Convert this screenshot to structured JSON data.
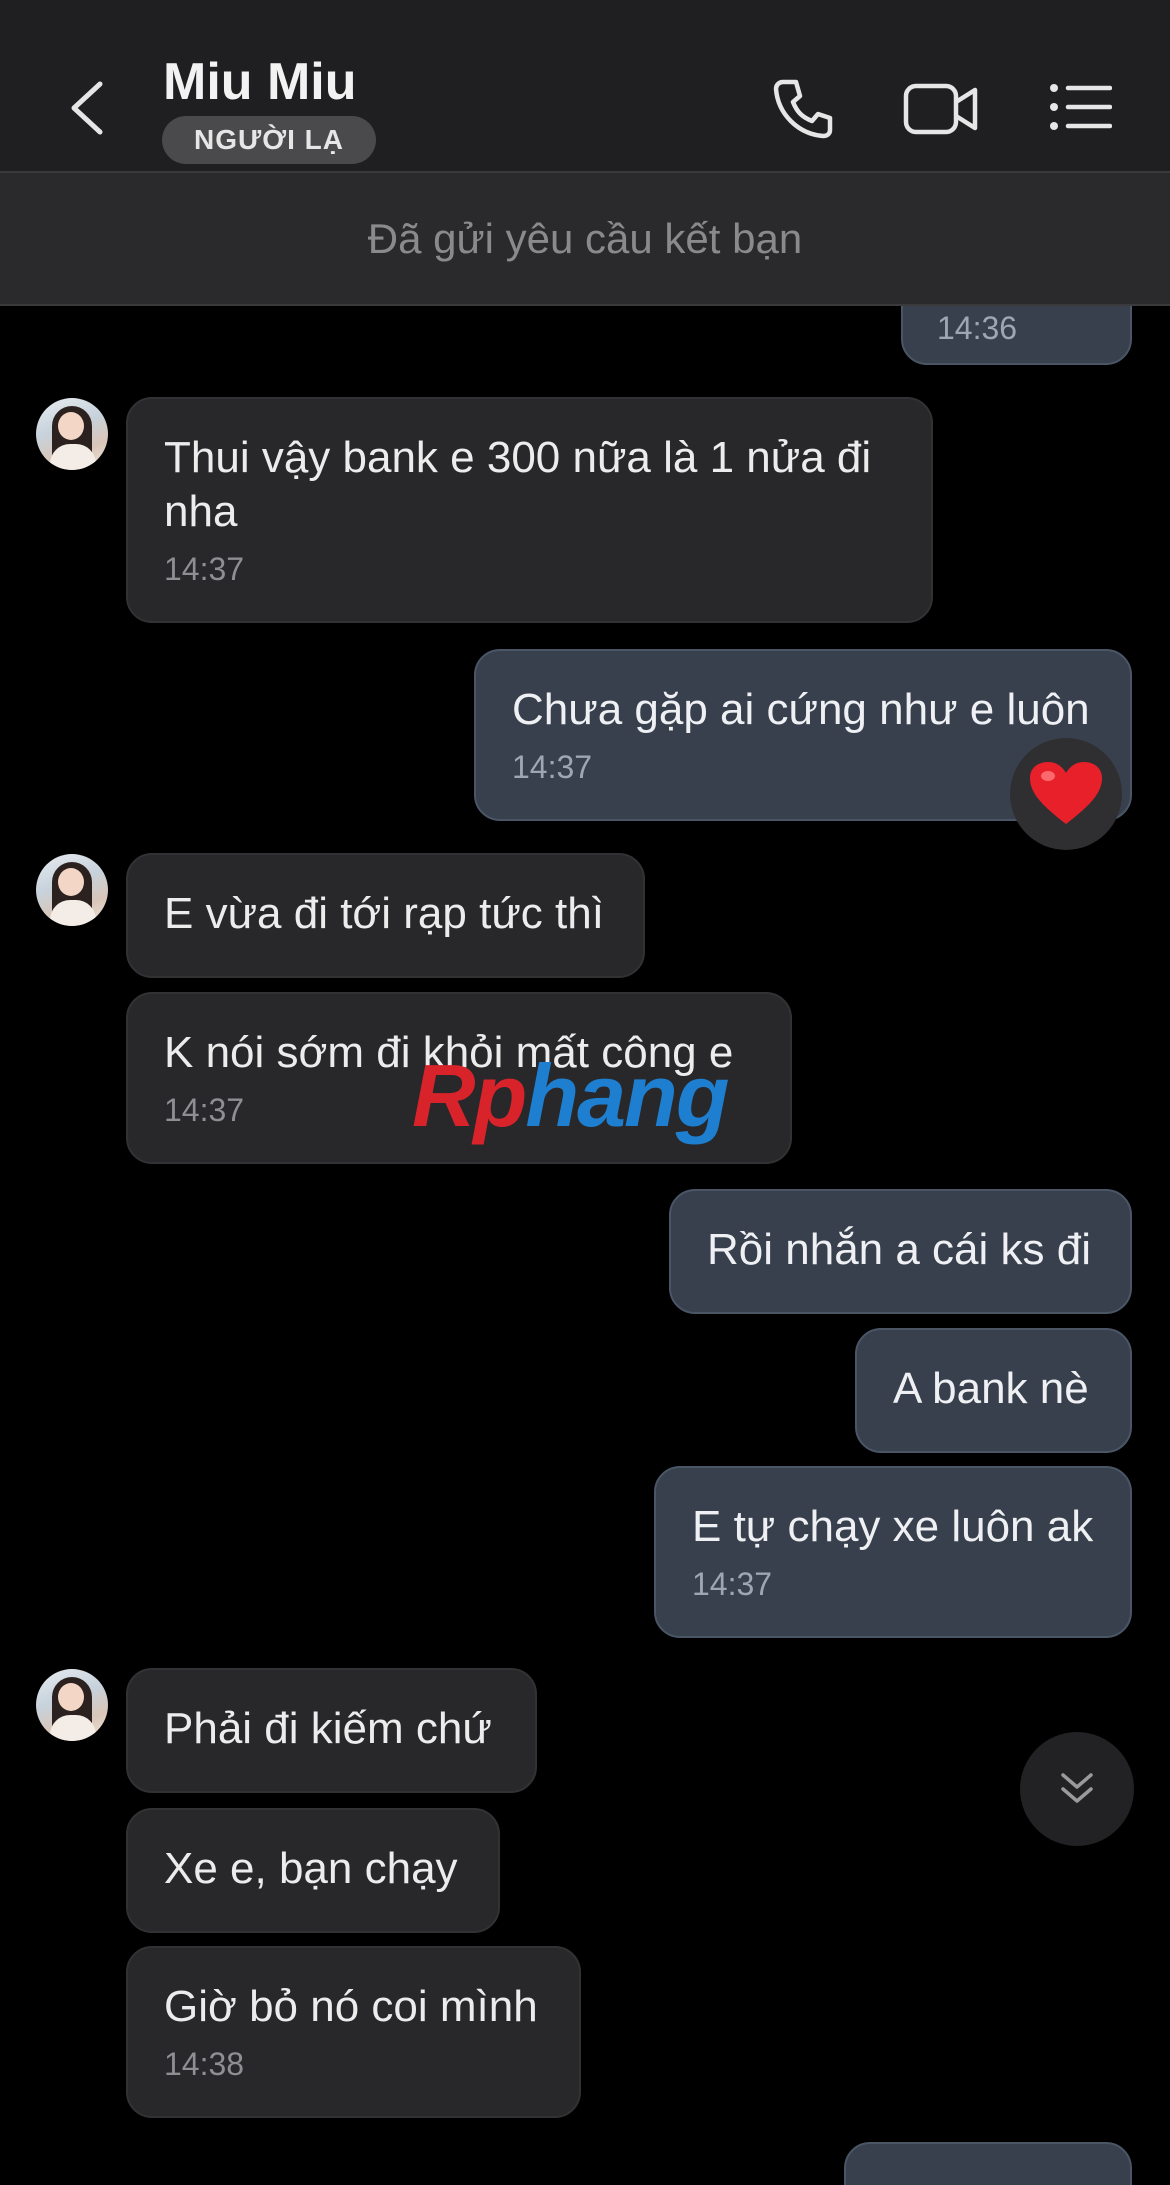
{
  "header": {
    "name": "Miu Miu",
    "badge": "NGƯỜI LẠ",
    "icons": [
      "chevron-left-icon",
      "phone-icon",
      "video-camera-icon",
      "list-menu-icon"
    ]
  },
  "banner": {
    "text": "Đã gửi yêu cầu kết bạn"
  },
  "messages": [
    {
      "dir": "out",
      "text": "",
      "time": "14:36"
    },
    {
      "dir": "in",
      "text": "Thui vậy bank e 300 nữa là 1 nửa đi nha",
      "time": "14:37"
    },
    {
      "dir": "out",
      "text": "Chưa gặp ai cứng như e luôn",
      "time": "14:37"
    },
    {
      "dir": "in",
      "text": "E vừa đi tới rạp tức thì",
      "time": ""
    },
    {
      "dir": "in",
      "text": "K nói sớm đi khỏi mất công e",
      "time": "14:37"
    },
    {
      "dir": "out",
      "text": "Rồi nhắn a cái ks đi",
      "time": ""
    },
    {
      "dir": "out",
      "text": "A bank nè",
      "time": ""
    },
    {
      "dir": "out",
      "text": "E tự chạy xe luôn ak",
      "time": "14:37"
    },
    {
      "dir": "in",
      "text": "Phải đi kiếm chứ",
      "time": ""
    },
    {
      "dir": "in",
      "text": "Xe e, bạn chạy",
      "time": ""
    },
    {
      "dir": "in",
      "text": "Giờ bỏ nó coi mình",
      "time": "14:38"
    }
  ],
  "reaction": {
    "emoji": "❤️",
    "icon": "heart-icon"
  },
  "scroll_button": {
    "icon": "double-chevron-down-icon"
  },
  "watermark": {
    "part1": "Rp",
    "part2": "hang"
  },
  "colors": {
    "incoming": "#28282a",
    "outgoing": "#38404d",
    "header": "#1f1f21"
  }
}
